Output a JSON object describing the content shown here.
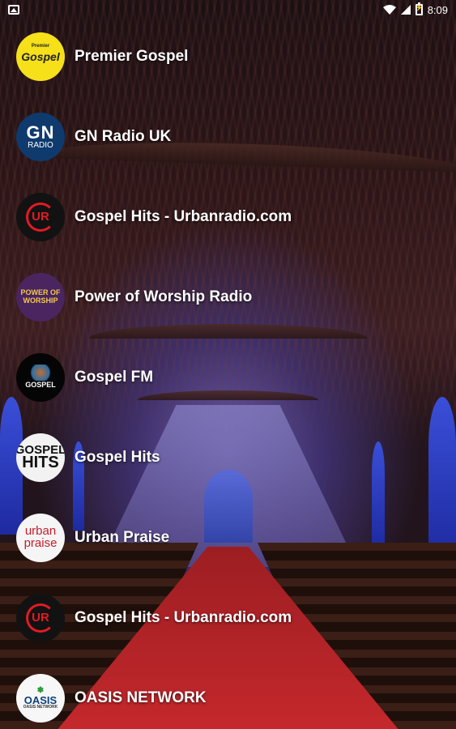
{
  "status_bar": {
    "time": "8:09"
  },
  "stations": [
    {
      "name": "Premier Gospel",
      "logo_text": "Gospel",
      "logo_small": "Premier"
    },
    {
      "name": "GN Radio UK",
      "logo_text": "GN",
      "logo_small": "RADIO"
    },
    {
      "name": "Gospel Hits - Urbanradio.com",
      "logo_text": "UR"
    },
    {
      "name": "Power of Worship Radio",
      "logo_text": "POWER OF WORSHIP"
    },
    {
      "name": "Gospel FM",
      "logo_text": "GOSPEL"
    },
    {
      "name": "Gospel Hits",
      "logo_text": "GOSPEL",
      "logo_small": "HITS"
    },
    {
      "name": "Urban Praise",
      "logo_text": "urban",
      "logo_small": "praise"
    },
    {
      "name": "Gospel Hits - Urbanradio.com",
      "logo_text": "UR"
    },
    {
      "name": "OASIS NETWORK",
      "logo_text": "OASIS",
      "logo_small": "OASIS NETWORK"
    }
  ],
  "colors": {
    "text": "#ffffff",
    "premier_logo_bg": "#f5e01a",
    "ur_red": "#e21b23",
    "aisle_red": "#c4282c"
  },
  "icons": [
    "image-notification-icon",
    "wifi-icon",
    "signal-icon",
    "battery-charging-icon"
  ]
}
